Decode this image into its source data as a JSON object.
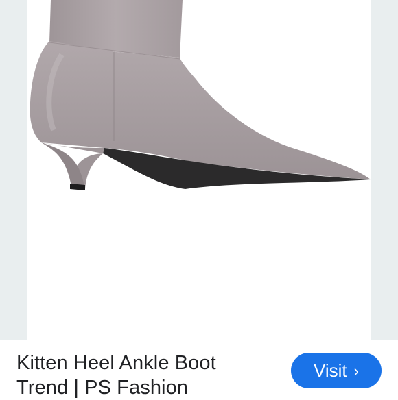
{
  "result": {
    "title_line1": "Kitten Heel Ankle Boot",
    "title_line2": "Trend | PS Fashion"
  },
  "actions": {
    "visit_label": "Visit",
    "visit_icon": "chevron-right-icon",
    "accent_color": "#1a73e8"
  },
  "image": {
    "subject": "product-photo",
    "boot_color": "#a59b9e"
  }
}
